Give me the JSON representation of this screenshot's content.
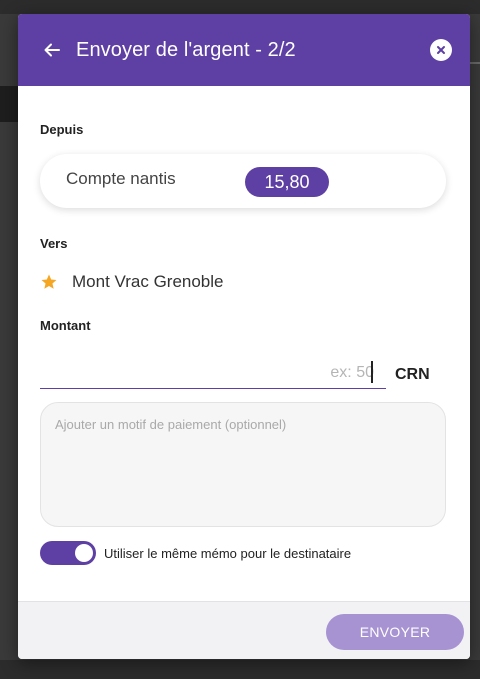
{
  "dialog": {
    "title": "Envoyer de l'argent - 2/2",
    "accent_color": "#5e3fa3"
  },
  "from": {
    "label": "Depuis",
    "account_name": "Compte nantis",
    "balance": "15,80"
  },
  "to": {
    "label": "Vers",
    "recipient_name": "Mont Vrac Grenoble",
    "favorite_icon": "star-icon",
    "favorite_color": "#f5a623"
  },
  "amount": {
    "label": "Montant",
    "placeholder": "ex: 50",
    "value": "",
    "currency": "CRN"
  },
  "memo": {
    "placeholder": "Ajouter un motif de paiement (optionnel)",
    "value": ""
  },
  "memo_toggle": {
    "label": "Utiliser le même mémo pour le destinataire",
    "on": true
  },
  "footer": {
    "submit_label": "ENVOYER",
    "submit_color": "#a793d1"
  }
}
